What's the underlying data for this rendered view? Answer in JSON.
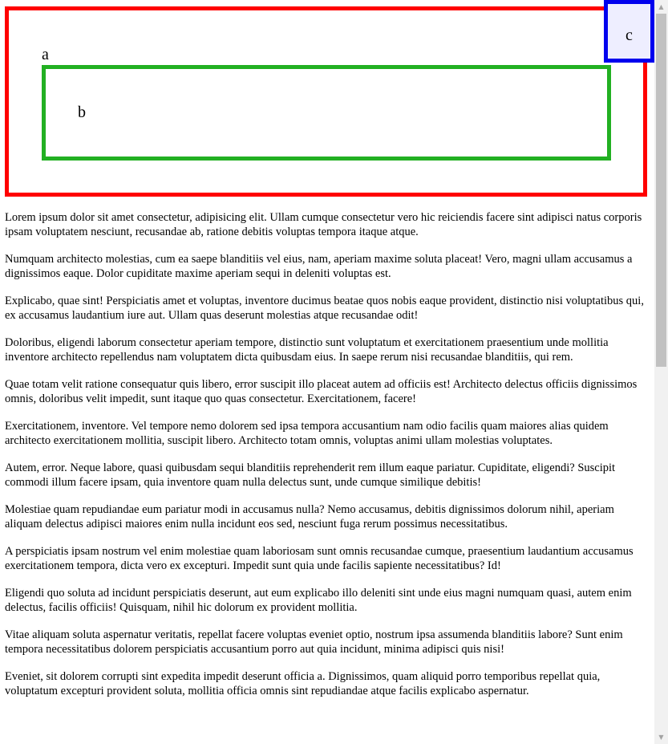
{
  "boxes": {
    "a": {
      "label": "a",
      "border_color": "#ff0000"
    },
    "b": {
      "label": "b",
      "border_color": "#22b022"
    },
    "c": {
      "label": "c",
      "border_color": "#0000ee",
      "background": "#eeeeff"
    }
  },
  "paragraphs": [
    "Lorem ipsum dolor sit amet consectetur, adipisicing elit. Ullam cumque consectetur vero hic reiciendis facere sint adipisci natus corporis ipsam voluptatem nesciunt, recusandae ab, ratione debitis voluptas tempora itaque atque.",
    "Numquam architecto molestias, cum ea saepe blanditiis vel eius, nam, aperiam maxime soluta placeat! Vero, magni ullam accusamus a dignissimos eaque. Dolor cupiditate maxime aperiam sequi in deleniti voluptas est.",
    "Explicabo, quae sint! Perspiciatis amet et voluptas, inventore ducimus beatae quos nobis eaque provident, distinctio nisi voluptatibus qui, ex accusamus laudantium iure aut. Ullam quas deserunt molestias atque recusandae odit!",
    "Doloribus, eligendi laborum consectetur aperiam tempore, distinctio sunt voluptatum et exercitationem praesentium unde mollitia inventore architecto repellendus nam voluptatem dicta quibusdam eius. In saepe rerum nisi recusandae blanditiis, qui rem.",
    "Quae totam velit ratione consequatur quis libero, error suscipit illo placeat autem ad officiis est! Architecto delectus officiis dignissimos omnis, doloribus velit impedit, sunt itaque quo quas consectetur. Exercitationem, facere!",
    "Exercitationem, inventore. Vel tempore nemo dolorem sed ipsa tempora accusantium nam odio facilis quam maiores alias quidem architecto exercitationem mollitia, suscipit libero. Architecto totam omnis, voluptas animi ullam molestias voluptates.",
    "Autem, error. Neque labore, quasi quibusdam sequi blanditiis reprehenderit rem illum eaque pariatur. Cupiditate, eligendi? Suscipit commodi illum facere ipsam, quia inventore quam nulla delectus sunt, unde cumque similique debitis!",
    "Molestiae quam repudiandae eum pariatur modi in accusamus nulla? Nemo accusamus, debitis dignissimos dolorum nihil, aperiam aliquam delectus adipisci maiores enim nulla incidunt eos sed, nesciunt fuga rerum possimus necessitatibus.",
    "A perspiciatis ipsam nostrum vel enim molestiae quam laboriosam sunt omnis recusandae cumque, praesentium laudantium accusamus exercitationem tempora, dicta vero ex excepturi. Impedit sunt quia unde facilis sapiente necessitatibus? Id!",
    "Eligendi quo soluta ad incidunt perspiciatis deserunt, aut eum explicabo illo deleniti sint unde eius magni numquam quasi, autem enim delectus, facilis officiis! Quisquam, nihil hic dolorum ex provident mollitia.",
    "Vitae aliquam soluta aspernatur veritatis, repellat facere voluptas eveniet optio, nostrum ipsa assumenda blanditiis labore? Sunt enim tempora necessitatibus dolorem perspiciatis accusantium porro aut quia incidunt, minima adipisci quis nisi!",
    "Eveniet, sit dolorem corrupti sint expedita impedit deserunt officia a. Dignissimos, quam aliquid porro temporibus repellat quia, voluptatum excepturi provident soluta, mollitia officia omnis sint repudiandae atque facilis explicabo aspernatur."
  ],
  "scrollbar": {
    "up_icon": "arrow-up-icon",
    "down_icon": "arrow-down-icon"
  }
}
